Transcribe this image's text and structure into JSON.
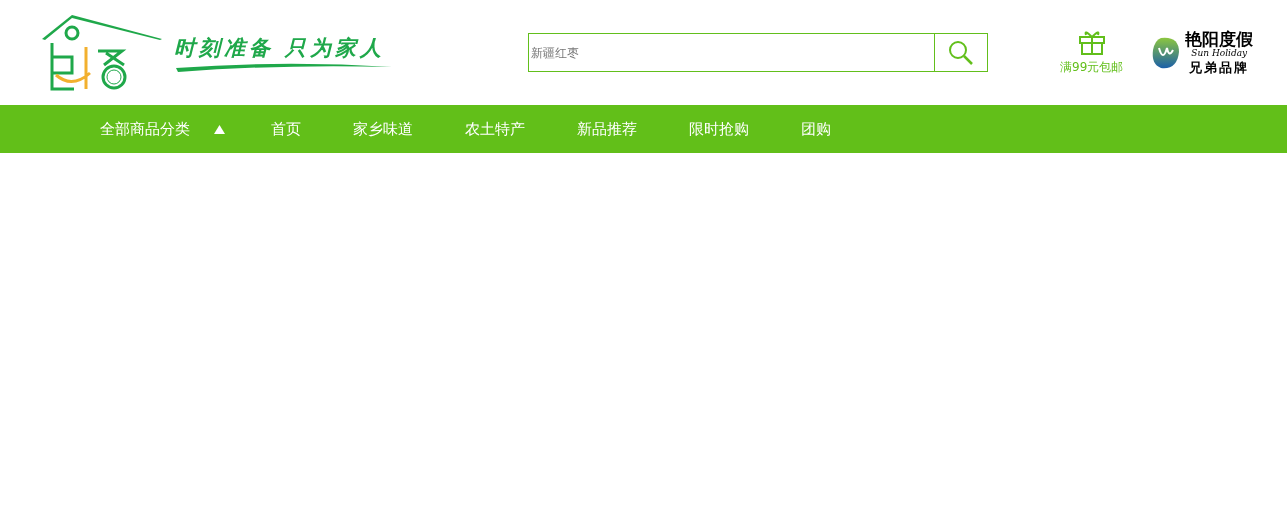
{
  "logo": {
    "slogan": "时刻准备 只为家人"
  },
  "search": {
    "placeholder": "新疆红枣"
  },
  "promo": {
    "label": "满99元包邮"
  },
  "partner": {
    "name": "艳阳度假",
    "subtitle": "Sun Holiday",
    "tagline": "兄弟品牌"
  },
  "nav": {
    "category": {
      "label": "全部商品分类",
      "expanded": true
    },
    "items": [
      {
        "label": "首页"
      },
      {
        "label": "家乡味道"
      },
      {
        "label": "农土特产"
      },
      {
        "label": "新品推荐"
      },
      {
        "label": "限时抢购"
      },
      {
        "label": "团购"
      }
    ]
  }
}
